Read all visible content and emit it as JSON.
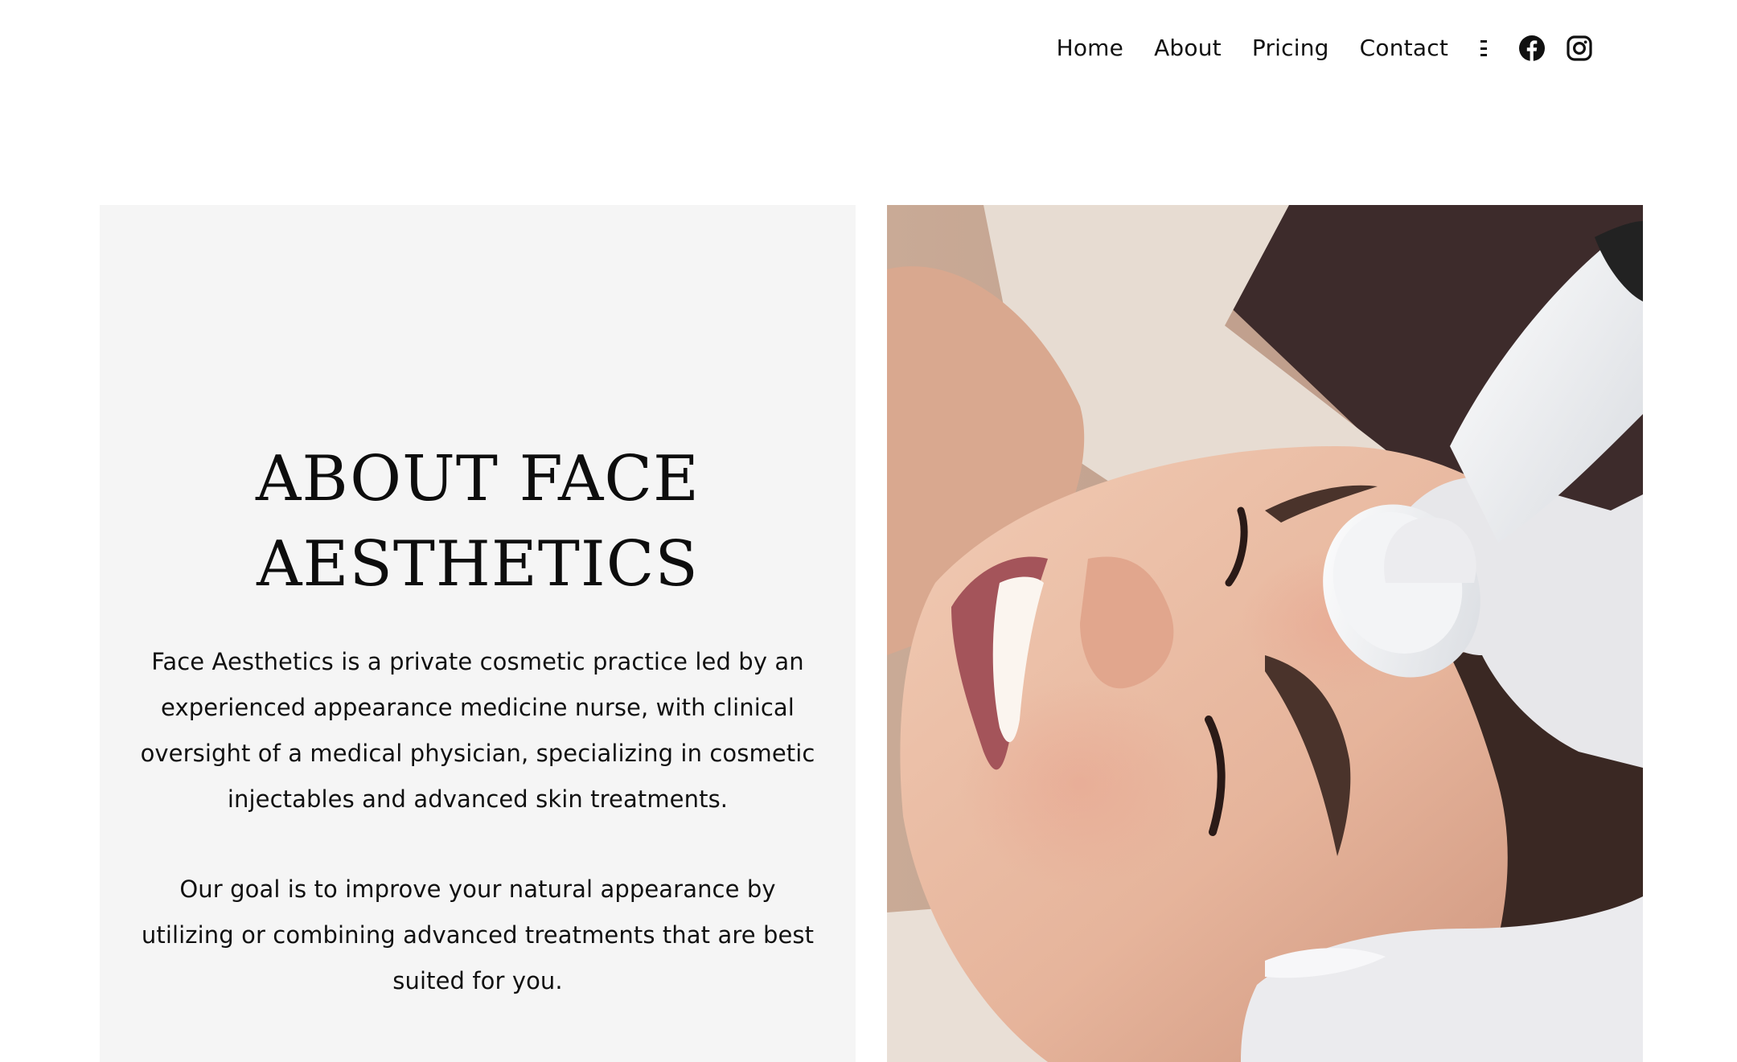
{
  "nav": {
    "links": [
      {
        "label": "Home"
      },
      {
        "label": "About"
      },
      {
        "label": "Pricing"
      },
      {
        "label": "Contact"
      }
    ],
    "more_icon": "more-menu-icon",
    "social": [
      {
        "icon": "facebook-icon"
      },
      {
        "icon": "instagram-icon"
      }
    ]
  },
  "about": {
    "title": "ABOUT FACE AESTHETICS",
    "paragraph_1": "Face Aesthetics is a private cosmetic practice led by an experienced appearance medicine nurse, with clinical oversight of a medical physician, specializing in cosmetic injectables and advanced skin treatments.",
    "paragraph_2": "Our goal is to improve your natural appearance by utilizing or combining advanced treatments that are best suited for you."
  },
  "colors": {
    "panel_background": "#f5f5f5",
    "text": "#111111",
    "page_background": "#ffffff"
  }
}
